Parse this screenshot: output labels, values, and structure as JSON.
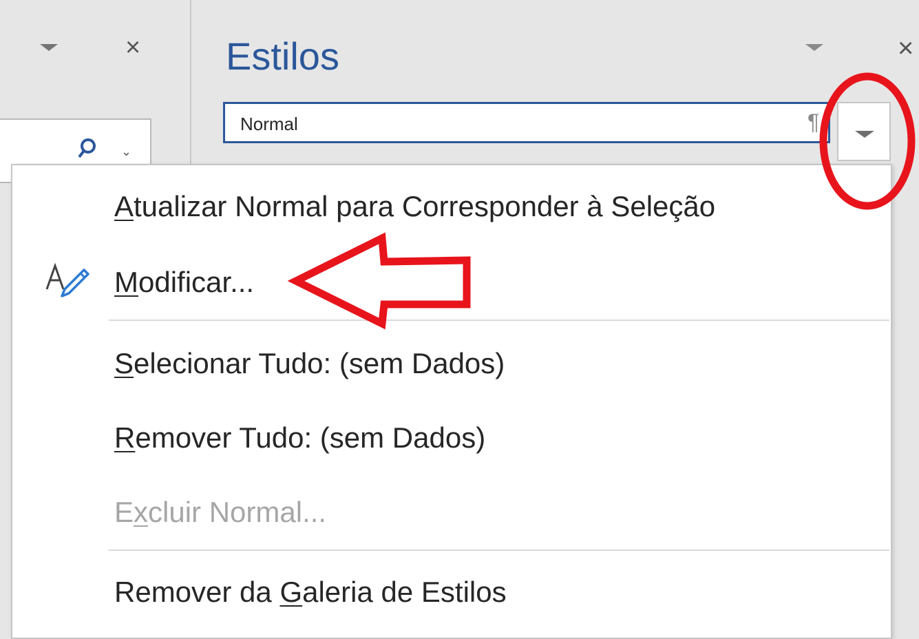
{
  "styles_pane": {
    "title": "Estilos",
    "current_style": "Normal",
    "paragraph_mark": "¶"
  },
  "left_pane": {
    "close_glyph": "×",
    "chevron_glyph": "⌄"
  },
  "context_menu": {
    "items": [
      {
        "pre": "",
        "acc": "A",
        "post": "tualizar Normal para Corresponder à Seleção",
        "enabled": true
      },
      {
        "pre": "",
        "acc": "M",
        "post": "odificar...",
        "enabled": true,
        "icon": "modify-style-icon"
      },
      {
        "pre": "",
        "acc": "S",
        "post": "elecionar Tudo: (sem Dados)",
        "enabled": true
      },
      {
        "pre": "",
        "acc": "R",
        "post": "emover Tudo: (sem Dados)",
        "enabled": true
      },
      {
        "pre": "E",
        "acc": "x",
        "post": "cluir Normal...",
        "enabled": false
      },
      {
        "pre": "Remover da ",
        "acc": "G",
        "post": "aleria de Estilos",
        "enabled": true
      }
    ]
  },
  "pane_close_glyph": "×",
  "annotations": {
    "color": "#e8141c",
    "circle": "style-dropdown-button",
    "arrow_points_to": "Modificar..."
  },
  "colors": {
    "accent": "#2b579a",
    "annotation_red": "#e8141c",
    "disabled_text": "#a6a6a6"
  }
}
